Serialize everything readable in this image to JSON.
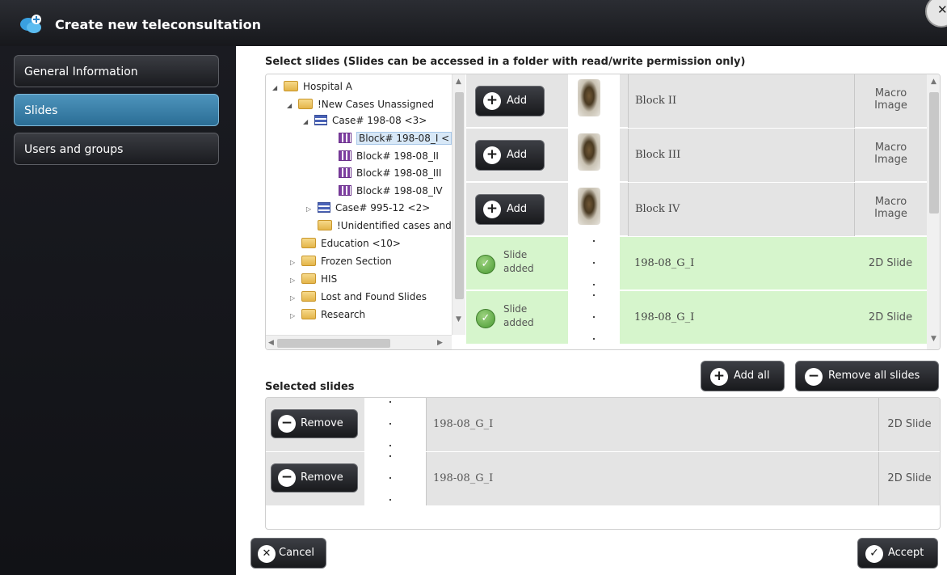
{
  "window": {
    "title": "Create new teleconsultation",
    "app_icon": "chat-bubbles-plus-icon",
    "close_label": "✕"
  },
  "sidebar": {
    "items": [
      {
        "label": "General Information",
        "active": false
      },
      {
        "label": "Slides",
        "active": true
      },
      {
        "label": "Users and groups",
        "active": false
      }
    ]
  },
  "main": {
    "select_heading": "Select slides (Slides can be accessed in a folder with read/write permission only)",
    "tree": [
      {
        "label": "Hospital A",
        "icon": "folder-icon",
        "expanded": true
      },
      {
        "label": "!New Cases Unassigned",
        "icon": "folder-icon",
        "expanded": true
      },
      {
        "label": "Case# 198-08 <3>",
        "icon": "case-icon",
        "expanded": true
      },
      {
        "label": "Block# 198-08_I <",
        "icon": "block-icon",
        "selected": true
      },
      {
        "label": "Block# 198-08_II",
        "icon": "block-icon"
      },
      {
        "label": "Block# 198-08_III",
        "icon": "block-icon"
      },
      {
        "label": "Block# 198-08_IV",
        "icon": "block-icon"
      },
      {
        "label": "Case# 995-12 <2>",
        "icon": "case-icon",
        "expanded": false
      },
      {
        "label": "!Unidentified cases and :",
        "icon": "folder-icon"
      },
      {
        "label": "Education <10>",
        "icon": "folder-icon"
      },
      {
        "label": "Frozen Section",
        "icon": "folder-icon",
        "expanded": false
      },
      {
        "label": "HIS",
        "icon": "folder-icon",
        "expanded": false
      },
      {
        "label": "Lost and Found Slides",
        "icon": "folder-icon",
        "expanded": false
      },
      {
        "label": "Research",
        "icon": "folder-icon",
        "expanded": false
      }
    ],
    "available_slides": [
      {
        "action": "Add",
        "name": "Block II",
        "type_line1": "Macro",
        "type_line2": "Image",
        "added": false
      },
      {
        "action": "Add",
        "name": "Block III",
        "type_line1": "Macro",
        "type_line2": "Image",
        "added": false
      },
      {
        "action": "Add",
        "name": "Block IV",
        "type_line1": "Macro",
        "type_line2": "Image",
        "added": false
      },
      {
        "status_line1": "Slide",
        "status_line2": "added",
        "name": "198-08_G_I",
        "type": "2D Slide",
        "added": true
      },
      {
        "status_line1": "Slide",
        "status_line2": "added",
        "name": "198-08_G_I",
        "type": "2D Slide",
        "added": true
      }
    ],
    "add_all_label": "Add all",
    "remove_all_label": "Remove all slides",
    "selected_heading": "Selected slides",
    "selected_slides": [
      {
        "action": "Remove",
        "name": "198-08_G_I",
        "type": "2D Slide"
      },
      {
        "action": "Remove",
        "name": "198-08_G_I",
        "type": "2D Slide"
      }
    ]
  },
  "footer": {
    "cancel_label": "Cancel",
    "accept_label": "Accept"
  },
  "colors": {
    "sidebar_active": "#3b82ad",
    "added_row": "#d6f5cc",
    "title_bar": "#1f2025"
  }
}
